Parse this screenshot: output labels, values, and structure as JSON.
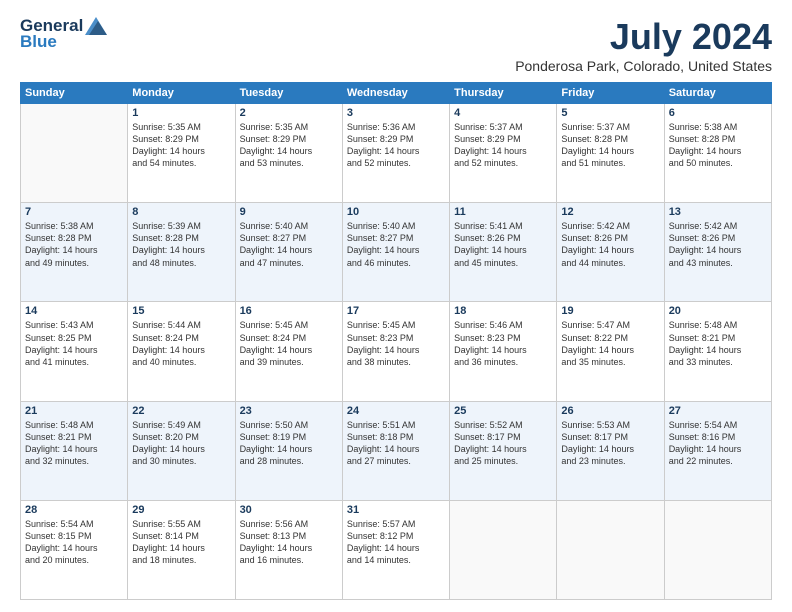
{
  "header": {
    "logo_general": "General",
    "logo_blue": "Blue",
    "main_title": "July 2024",
    "subtitle": "Ponderosa Park, Colorado, United States"
  },
  "days_of_week": [
    "Sunday",
    "Monday",
    "Tuesday",
    "Wednesday",
    "Thursday",
    "Friday",
    "Saturday"
  ],
  "weeks": [
    [
      {
        "day": "",
        "content": ""
      },
      {
        "day": "1",
        "content": "Sunrise: 5:35 AM\nSunset: 8:29 PM\nDaylight: 14 hours\nand 54 minutes."
      },
      {
        "day": "2",
        "content": "Sunrise: 5:35 AM\nSunset: 8:29 PM\nDaylight: 14 hours\nand 53 minutes."
      },
      {
        "day": "3",
        "content": "Sunrise: 5:36 AM\nSunset: 8:29 PM\nDaylight: 14 hours\nand 52 minutes."
      },
      {
        "day": "4",
        "content": "Sunrise: 5:37 AM\nSunset: 8:29 PM\nDaylight: 14 hours\nand 52 minutes."
      },
      {
        "day": "5",
        "content": "Sunrise: 5:37 AM\nSunset: 8:28 PM\nDaylight: 14 hours\nand 51 minutes."
      },
      {
        "day": "6",
        "content": "Sunrise: 5:38 AM\nSunset: 8:28 PM\nDaylight: 14 hours\nand 50 minutes."
      }
    ],
    [
      {
        "day": "7",
        "content": "Sunrise: 5:38 AM\nSunset: 8:28 PM\nDaylight: 14 hours\nand 49 minutes."
      },
      {
        "day": "8",
        "content": "Sunrise: 5:39 AM\nSunset: 8:28 PM\nDaylight: 14 hours\nand 48 minutes."
      },
      {
        "day": "9",
        "content": "Sunrise: 5:40 AM\nSunset: 8:27 PM\nDaylight: 14 hours\nand 47 minutes."
      },
      {
        "day": "10",
        "content": "Sunrise: 5:40 AM\nSunset: 8:27 PM\nDaylight: 14 hours\nand 46 minutes."
      },
      {
        "day": "11",
        "content": "Sunrise: 5:41 AM\nSunset: 8:26 PM\nDaylight: 14 hours\nand 45 minutes."
      },
      {
        "day": "12",
        "content": "Sunrise: 5:42 AM\nSunset: 8:26 PM\nDaylight: 14 hours\nand 44 minutes."
      },
      {
        "day": "13",
        "content": "Sunrise: 5:42 AM\nSunset: 8:26 PM\nDaylight: 14 hours\nand 43 minutes."
      }
    ],
    [
      {
        "day": "14",
        "content": "Sunrise: 5:43 AM\nSunset: 8:25 PM\nDaylight: 14 hours\nand 41 minutes."
      },
      {
        "day": "15",
        "content": "Sunrise: 5:44 AM\nSunset: 8:24 PM\nDaylight: 14 hours\nand 40 minutes."
      },
      {
        "day": "16",
        "content": "Sunrise: 5:45 AM\nSunset: 8:24 PM\nDaylight: 14 hours\nand 39 minutes."
      },
      {
        "day": "17",
        "content": "Sunrise: 5:45 AM\nSunset: 8:23 PM\nDaylight: 14 hours\nand 38 minutes."
      },
      {
        "day": "18",
        "content": "Sunrise: 5:46 AM\nSunset: 8:23 PM\nDaylight: 14 hours\nand 36 minutes."
      },
      {
        "day": "19",
        "content": "Sunrise: 5:47 AM\nSunset: 8:22 PM\nDaylight: 14 hours\nand 35 minutes."
      },
      {
        "day": "20",
        "content": "Sunrise: 5:48 AM\nSunset: 8:21 PM\nDaylight: 14 hours\nand 33 minutes."
      }
    ],
    [
      {
        "day": "21",
        "content": "Sunrise: 5:48 AM\nSunset: 8:21 PM\nDaylight: 14 hours\nand 32 minutes."
      },
      {
        "day": "22",
        "content": "Sunrise: 5:49 AM\nSunset: 8:20 PM\nDaylight: 14 hours\nand 30 minutes."
      },
      {
        "day": "23",
        "content": "Sunrise: 5:50 AM\nSunset: 8:19 PM\nDaylight: 14 hours\nand 28 minutes."
      },
      {
        "day": "24",
        "content": "Sunrise: 5:51 AM\nSunset: 8:18 PM\nDaylight: 14 hours\nand 27 minutes."
      },
      {
        "day": "25",
        "content": "Sunrise: 5:52 AM\nSunset: 8:17 PM\nDaylight: 14 hours\nand 25 minutes."
      },
      {
        "day": "26",
        "content": "Sunrise: 5:53 AM\nSunset: 8:17 PM\nDaylight: 14 hours\nand 23 minutes."
      },
      {
        "day": "27",
        "content": "Sunrise: 5:54 AM\nSunset: 8:16 PM\nDaylight: 14 hours\nand 22 minutes."
      }
    ],
    [
      {
        "day": "28",
        "content": "Sunrise: 5:54 AM\nSunset: 8:15 PM\nDaylight: 14 hours\nand 20 minutes."
      },
      {
        "day": "29",
        "content": "Sunrise: 5:55 AM\nSunset: 8:14 PM\nDaylight: 14 hours\nand 18 minutes."
      },
      {
        "day": "30",
        "content": "Sunrise: 5:56 AM\nSunset: 8:13 PM\nDaylight: 14 hours\nand 16 minutes."
      },
      {
        "day": "31",
        "content": "Sunrise: 5:57 AM\nSunset: 8:12 PM\nDaylight: 14 hours\nand 14 minutes."
      },
      {
        "day": "",
        "content": ""
      },
      {
        "day": "",
        "content": ""
      },
      {
        "day": "",
        "content": ""
      }
    ]
  ]
}
